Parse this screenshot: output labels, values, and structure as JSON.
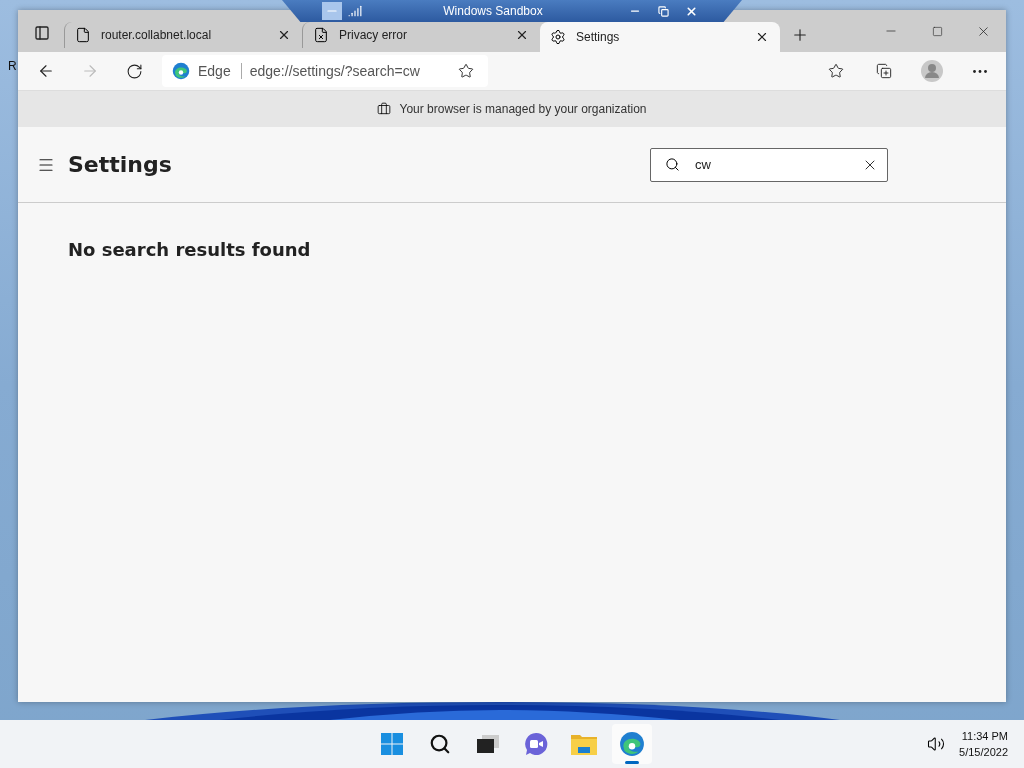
{
  "desktop": {
    "label": "R"
  },
  "sandbox_bar": {
    "title": "Windows Sandbox"
  },
  "tabs": [
    {
      "title": "router.collabnet.local",
      "selected": false,
      "kind": "page"
    },
    {
      "title": "Privacy error",
      "selected": false,
      "kind": "error"
    },
    {
      "title": "Settings",
      "selected": true,
      "kind": "settings"
    }
  ],
  "address_bar": {
    "site_label": "Edge",
    "url": "edge://settings/?search=cw"
  },
  "banner": {
    "text": "Your browser is managed by your organization"
  },
  "settings": {
    "title": "Settings",
    "search": {
      "value": "cw"
    },
    "message": "No search results found"
  },
  "taskbar": {
    "apps": [
      {
        "kind": "start",
        "active": false
      },
      {
        "kind": "search",
        "active": false
      },
      {
        "kind": "taskview",
        "active": false
      },
      {
        "kind": "chat",
        "active": false
      },
      {
        "kind": "explorer",
        "active": false
      },
      {
        "kind": "edge",
        "active": true
      }
    ],
    "time": "11:34 PM",
    "date": "5/15/2022"
  }
}
